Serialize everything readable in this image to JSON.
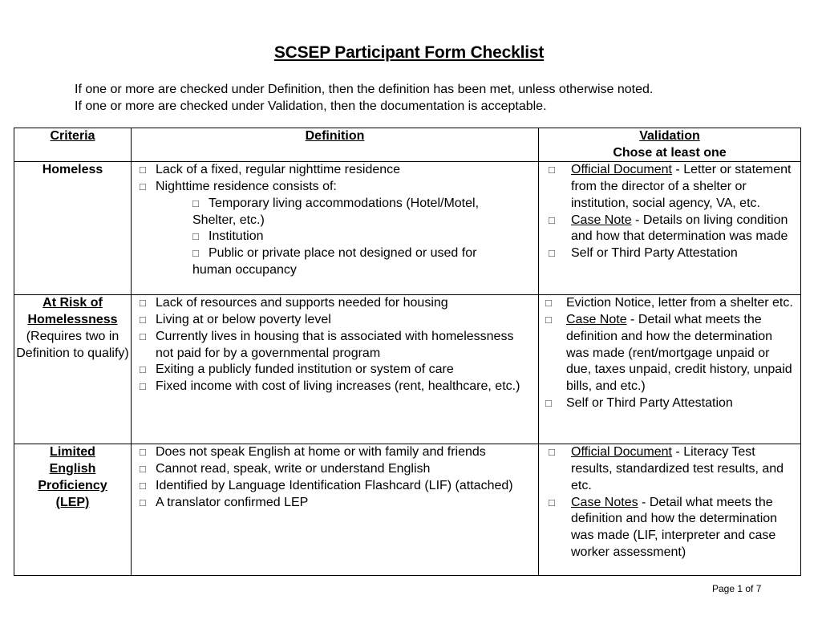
{
  "document": {
    "title": "SCSEP Participant Form Checklist",
    "intro": [
      "If one or more are checked under Definition, then the definition has been met, unless otherwise noted.",
      "If one or more are checked under Validation, then the documentation is acceptable."
    ],
    "footer": "Page 1 of 7"
  },
  "icons": {
    "checkbox": "□"
  },
  "table": {
    "headers": {
      "criteria": "Criteria",
      "definition": "Definition",
      "validation": "Validation",
      "validation_note": "Chose at least one"
    },
    "rows": [
      {
        "criteria": "Homeless",
        "definition": [
          {
            "text": " Lack of a fixed, regular nighttime residence"
          },
          {
            "text": "Nighttime residence consists of:"
          },
          {
            "text": "Temporary living accommodations (Hotel/Motel,",
            "cont": "Shelter, etc.)"
          },
          {
            "text": "Institution"
          },
          {
            "text": "Public or private place not designed or used for",
            "cont": "human occupancy"
          }
        ],
        "validation": [
          {
            "label": "Official Document",
            "text": " - Letter or statement from the director of a shelter or institution, social agency, VA, etc."
          },
          {
            "label": "Case Note",
            "text": " - Details on living condition and how that determination was made"
          },
          {
            "label": "",
            "text": "Self or Third Party Attestation"
          }
        ]
      },
      {
        "criteria_title_1": "At Risk of",
        "criteria_title_2": "Homelessness",
        "criteria_note": "(Requires two in Definition to qualify)",
        "definition": [
          {
            "text": "Lack of resources and supports needed for housing"
          },
          {
            "text": "Living at or below poverty level"
          },
          {
            "text": "Currently lives in housing that is associated with homelessness not paid for by a governmental program"
          },
          {
            "text": "Exiting a publicly funded institution or system of care"
          },
          {
            "text": "Fixed income with cost of living increases (rent, healthcare, etc.)"
          }
        ],
        "validation": [
          {
            "label": "",
            "text": "Eviction Notice, letter from a shelter etc."
          },
          {
            "label": "Case Note",
            "text": " - Detail what meets the definition and how the determination was made (rent/mortgage unpaid or due, taxes unpaid, credit history, unpaid bills, and etc.)"
          },
          {
            "label": "",
            "text": "Self or Third Party Attestation"
          }
        ]
      },
      {
        "criteria_lines": [
          "Limited",
          "English",
          "Proficiency",
          "(LEP)"
        ],
        "definition": [
          {
            "text": "Does not speak English at home or with family and friends"
          },
          {
            "text": "Cannot read, speak, write or understand English"
          },
          {
            "text": "Identified by Language Identification Flashcard (LIF) (attached)"
          },
          {
            "text": "A translator confirmed LEP"
          }
        ],
        "validation": [
          {
            "label": "Official Document",
            "text": " - Literacy Test results, standardized test results, and etc."
          },
          {
            "label": "Case Notes",
            "text": " - Detail what meets the definition and how the determination was made (LIF, interpreter and case worker assessment)"
          }
        ]
      }
    ]
  }
}
